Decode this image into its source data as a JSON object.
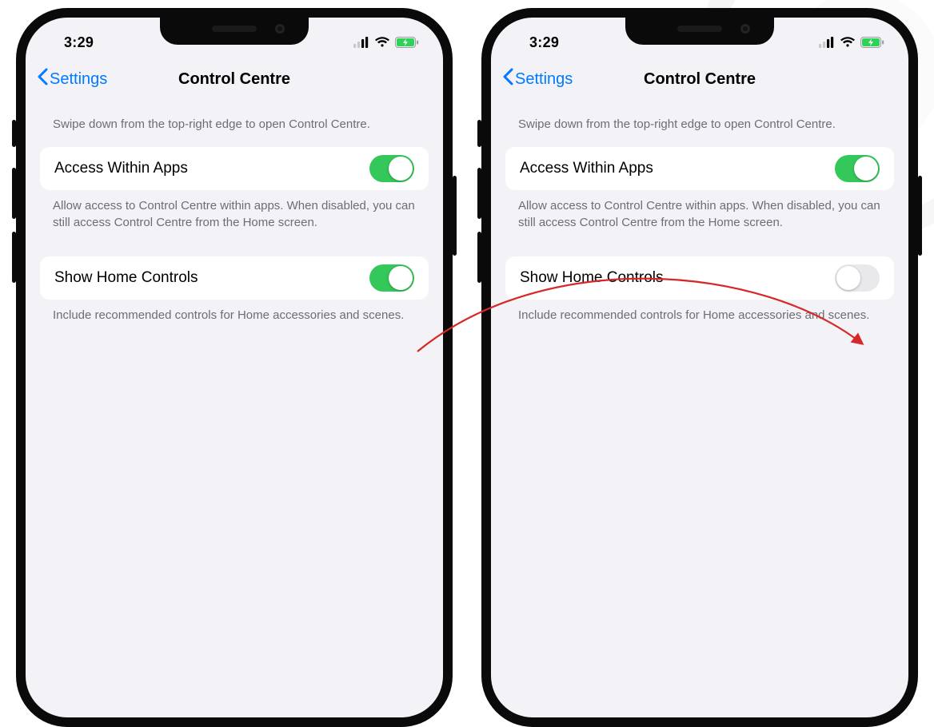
{
  "status": {
    "time": "3:29"
  },
  "nav": {
    "back": "Settings",
    "title": "Control Centre"
  },
  "section1": {
    "desc": "Swipe down from the top-right edge to open Control Centre.",
    "row_label": "Access Within Apps",
    "footer": "Allow access to Control Centre within apps. When disabled, you can still access Control Centre from the Home screen."
  },
  "section2": {
    "row_label": "Show Home Controls",
    "footer": "Include recommended controls for Home accessories and scenes."
  },
  "left": {
    "access_within_apps_on": true,
    "show_home_controls_on": true
  },
  "right": {
    "access_within_apps_on": true,
    "show_home_controls_on": false
  }
}
